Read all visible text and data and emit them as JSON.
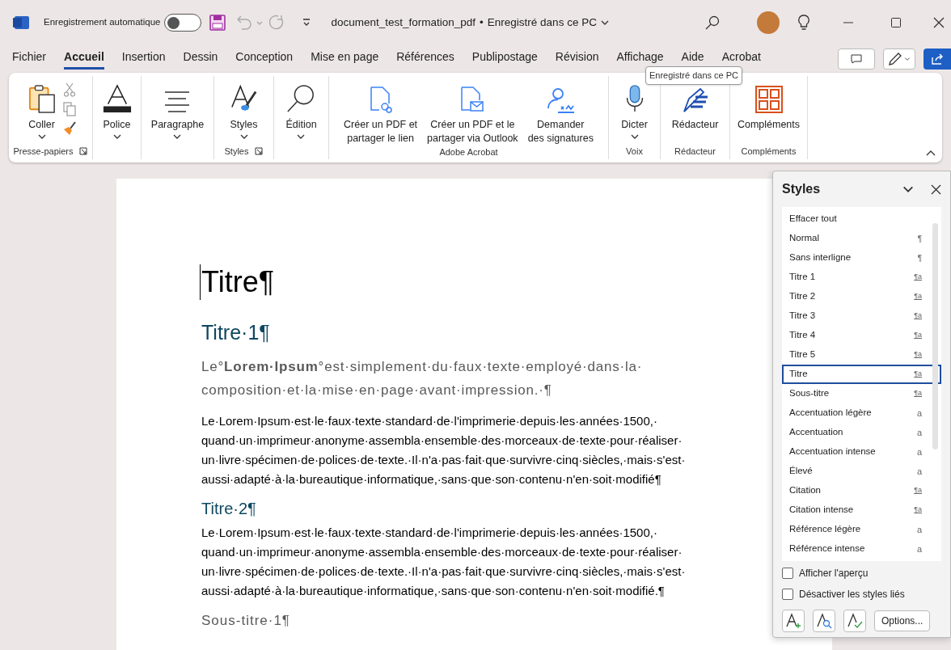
{
  "title_bar": {
    "autosave_label": "Enregistrement automatique",
    "autosave_on": false,
    "document_title": "document_test_formation_pdf",
    "separator": "•",
    "save_status": "Enregistré dans ce PC"
  },
  "tabs": [
    {
      "label": "Fichier",
      "selected": false
    },
    {
      "label": "Accueil",
      "selected": true
    },
    {
      "label": "Insertion",
      "selected": false
    },
    {
      "label": "Dessin",
      "selected": false
    },
    {
      "label": "Conception",
      "selected": false
    },
    {
      "label": "Mise en page",
      "selected": false
    },
    {
      "label": "Références",
      "selected": false
    },
    {
      "label": "Publipostage",
      "selected": false
    },
    {
      "label": "Révision",
      "selected": false
    },
    {
      "label": "Affichage",
      "selected": false
    },
    {
      "label": "Aide",
      "selected": false
    },
    {
      "label": "Acrobat",
      "selected": false
    }
  ],
  "tooltip": "Enregistré dans ce PC",
  "ribbon": [
    {
      "label": "Presse-papiers",
      "launcher": true,
      "commands": [
        {
          "label": "Coller",
          "dropdown": true
        }
      ]
    },
    {
      "launcher": false,
      "commands": [
        {
          "label": "Police",
          "dropdown": true
        }
      ]
    },
    {
      "launcher": false,
      "commands": [
        {
          "label": "Paragraphe",
          "dropdown": true
        }
      ]
    },
    {
      "label": "Styles",
      "launcher": true,
      "commands": [
        {
          "label": "Styles",
          "dropdown": true
        }
      ]
    },
    {
      "launcher": false,
      "commands": [
        {
          "label": "Édition",
          "dropdown": true
        }
      ]
    },
    {
      "label": "Adobe Acrobat",
      "launcher": false,
      "commands": [
        {
          "label": "Créer un PDF et\npartager le lien",
          "dropdown": false
        },
        {
          "label": "Créer un PDF et le\npartager via Outlook",
          "dropdown": false
        },
        {
          "label": "Demander\ndes signatures",
          "dropdown": false
        }
      ]
    },
    {
      "label": "Voix",
      "launcher": false,
      "commands": [
        {
          "label": "Dicter",
          "dropdown": true
        }
      ]
    },
    {
      "label": "Rédacteur",
      "launcher": false,
      "commands": [
        {
          "label": "Rédacteur",
          "dropdown": false
        }
      ]
    },
    {
      "label": "Compléments",
      "launcher": false,
      "commands": [
        {
          "label": "Compléments",
          "dropdown": false
        }
      ]
    }
  ],
  "document": [
    {
      "kind": "title",
      "lines": [
        "Titre¶"
      ]
    },
    {
      "kind": "heading1",
      "lines": [
        "Titre·1¶"
      ]
    },
    {
      "kind": "subtitle",
      "lines": [
        "Le°**Lorem·Ipsum**°est·simplement·du·faux·texte·employé·dans·la·",
        "composition·et·la·mise·en·page·avant·impression.·¶"
      ]
    },
    {
      "kind": "body",
      "lines": [
        "Le·Lorem·Ipsum·est·le·faux·texte·standard·de·l'imprimerie·depuis·les·années·1500,·",
        "quand·un·imprimeur·anonyme·assembla·ensemble·des·morceaux·de·texte·pour·réaliser·",
        "un·livre·spécimen·de·polices·de·texte.·Il·n'a·pas·fait·que·survivre·cinq·siècles,·mais·s'est·",
        "aussi·adapté·à·la·bureautique·informatique,·sans·que·son·contenu·n'en·soit·modifié¶"
      ]
    },
    {
      "kind": "heading2",
      "lines": [
        "Titre·2¶"
      ]
    },
    {
      "kind": "body",
      "lines": [
        "Le·Lorem·Ipsum·est·le·faux·texte·standard·de·l'imprimerie·depuis·les·années·1500,·",
        "quand·un·imprimeur·anonyme·assembla·ensemble·des·morceaux·de·texte·pour·réaliser·",
        "un·livre·spécimen·de·polices·de·texte.·Il·n'a·pas·fait·que·survivre·cinq·siècles,·mais·s'est·",
        "aussi·adapté·à·la·bureautique·informatique,·sans·que·son·contenu·n'en·soit·modifié.¶"
      ]
    },
    {
      "kind": "subtitle2",
      "lines": [
        "Sous-titre·1¶"
      ]
    }
  ],
  "styles_pane": {
    "title": "Styles",
    "items": [
      {
        "name": "Effacer tout",
        "kind": "none",
        "selected": false
      },
      {
        "name": "Normal",
        "kind": "paragraph",
        "marker": "¶",
        "selected": false
      },
      {
        "name": "Sans interligne",
        "kind": "paragraph",
        "marker": "¶",
        "selected": false
      },
      {
        "name": "Titre 1",
        "kind": "linked",
        "marker": "¶a",
        "selected": false
      },
      {
        "name": "Titre 2",
        "kind": "linked",
        "marker": "¶a",
        "selected": false
      },
      {
        "name": "Titre 3",
        "kind": "linked",
        "marker": "¶a",
        "selected": false
      },
      {
        "name": "Titre 4",
        "kind": "linked",
        "marker": "¶a",
        "selected": false
      },
      {
        "name": "Titre 5",
        "kind": "linked",
        "marker": "¶a",
        "selected": false
      },
      {
        "name": "Titre",
        "kind": "linked",
        "marker": "¶a",
        "selected": true
      },
      {
        "name": "Sous-titre",
        "kind": "linked",
        "marker": "¶a",
        "selected": false
      },
      {
        "name": "Accentuation légère",
        "kind": "character",
        "marker": "a",
        "selected": false
      },
      {
        "name": "Accentuation",
        "kind": "character",
        "marker": "a",
        "selected": false
      },
      {
        "name": "Accentuation intense",
        "kind": "character",
        "marker": "a",
        "selected": false
      },
      {
        "name": "Élevé",
        "kind": "character",
        "marker": "a",
        "selected": false
      },
      {
        "name": "Citation",
        "kind": "linked",
        "marker": "¶a",
        "selected": false
      },
      {
        "name": "Citation intense",
        "kind": "linked",
        "marker": "¶a",
        "selected": false
      },
      {
        "name": "Référence légère",
        "kind": "character",
        "marker": "a",
        "selected": false
      },
      {
        "name": "Référence intense",
        "kind": "character",
        "marker": "a",
        "selected": false
      }
    ],
    "options": [
      {
        "label": "Afficher l'aperçu",
        "checked": false
      },
      {
        "label": "Désactiver les styles liés",
        "checked": false
      }
    ],
    "options_button": "Options..."
  }
}
